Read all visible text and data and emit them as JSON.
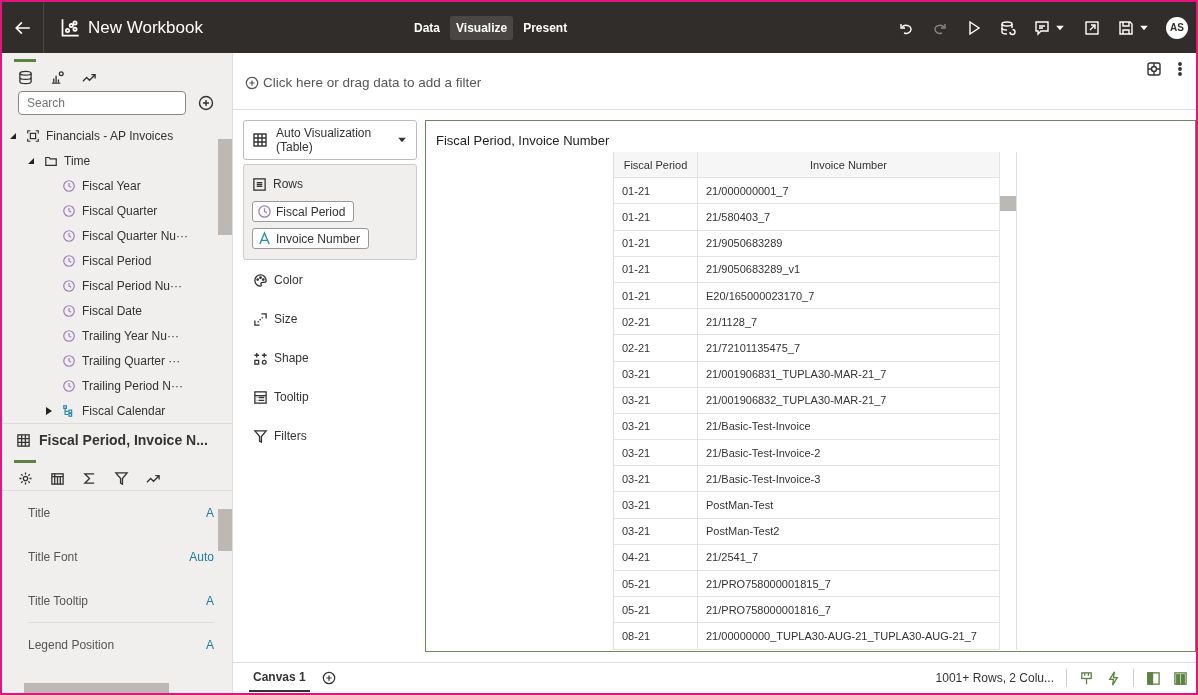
{
  "window": {
    "title": "New Workbook"
  },
  "modes": [
    {
      "label": "Data",
      "selected": false
    },
    {
      "label": "Visualize",
      "selected": true
    },
    {
      "label": "Present",
      "selected": false
    }
  ],
  "toolbar": [
    {
      "kind": "undo",
      "disabled": false
    },
    {
      "kind": "redo",
      "disabled": true
    },
    {
      "kind": "play",
      "disabled": false
    },
    {
      "kind": "refresh",
      "disabled": false
    },
    {
      "kind": "comment",
      "disabled": false
    },
    {
      "kind": "export",
      "disabled": false
    },
    {
      "kind": "save",
      "disabled": false
    }
  ],
  "user": {
    "initials": "AS"
  },
  "panel_tabs": [
    {
      "kind": "data",
      "selected": true
    },
    {
      "kind": "viz",
      "selected": false
    },
    {
      "kind": "analytics",
      "selected": false
    }
  ],
  "search": {
    "placeholder": "Search"
  },
  "tree": [
    {
      "label": "Financials - AP Invoices",
      "kind": "subject",
      "expanded": true,
      "children": [
        {
          "label": "Time",
          "kind": "folder",
          "expanded": true,
          "children": [
            {
              "label": "Fiscal Year",
              "kind": "time"
            },
            {
              "label": "Fiscal Quarter",
              "kind": "time"
            },
            {
              "label": "Fiscal Quarter Nu···",
              "kind": "time"
            },
            {
              "label": "Fiscal Period",
              "kind": "time"
            },
            {
              "label": "Fiscal Period Nu···",
              "kind": "time"
            },
            {
              "label": "Fiscal Date",
              "kind": "time"
            },
            {
              "label": "Trailing Year Nu···",
              "kind": "time"
            },
            {
              "label": "Trailing Quarter ···",
              "kind": "time"
            },
            {
              "label": "Trailing Period N···",
              "kind": "time"
            },
            {
              "label": "Fiscal Calendar",
              "kind": "hierarchy",
              "expanded": false
            }
          ]
        }
      ]
    }
  ],
  "properties": {
    "title": "Fiscal Period, Invoice N...",
    "tabs": [
      {
        "kind": "general",
        "selected": true
      },
      {
        "kind": "columns",
        "selected": false
      },
      {
        "kind": "values",
        "selected": false
      },
      {
        "kind": "filters",
        "selected": false
      },
      {
        "kind": "analytics",
        "selected": false
      }
    ],
    "rows": [
      {
        "label": "Title",
        "value": "A"
      },
      {
        "label": "Title Font",
        "value": "Auto"
      },
      {
        "label": "Title Tooltip",
        "value": "A"
      },
      {
        "label": "Legend Position",
        "value": "A"
      }
    ]
  },
  "filter_bar": {
    "prompt": "Click here or drag data to add a filter"
  },
  "grammar": {
    "viz_type": "Auto Visualization (Table)",
    "sections": [
      {
        "label": "Rows",
        "kind": "rows",
        "items": [
          {
            "label": "Fiscal Period",
            "kind": "time"
          },
          {
            "label": "Invoice Number",
            "kind": "text"
          }
        ]
      },
      {
        "label": "Color",
        "kind": "color"
      },
      {
        "label": "Size",
        "kind": "size"
      },
      {
        "label": "Shape",
        "kind": "shape"
      },
      {
        "label": "Tooltip",
        "kind": "tooltip"
      },
      {
        "label": "Filters",
        "kind": "filters"
      }
    ]
  },
  "visualization": {
    "title": "Fiscal Period, Invoice Number",
    "columns": [
      "Fiscal Period",
      "Invoice Number"
    ],
    "rows": [
      [
        "01-21",
        "21/000000001_7"
      ],
      [
        "01-21",
        "21/580403_7"
      ],
      [
        "01-21",
        "21/9050683289"
      ],
      [
        "01-21",
        "21/9050683289_v1"
      ],
      [
        "01-21",
        "E20/165000023170_7"
      ],
      [
        "02-21",
        "21/1128_7"
      ],
      [
        "02-21",
        "21/72101135475_7"
      ],
      [
        "03-21",
        "21/001906831_TUPLA30-MAR-21_7"
      ],
      [
        "03-21",
        "21/001906832_TUPLA30-MAR-21_7"
      ],
      [
        "03-21",
        "21/Basic-Test-Invoice"
      ],
      [
        "03-21",
        "21/Basic-Test-Invoice-2"
      ],
      [
        "03-21",
        "21/Basic-Test-Invoice-3"
      ],
      [
        "03-21",
        "PostMan-Test"
      ],
      [
        "03-21",
        "PostMan-Test2"
      ],
      [
        "04-21",
        "21/2541_7"
      ],
      [
        "05-21",
        "21/PRO758000001815_7"
      ],
      [
        "05-21",
        "21/PRO758000001816_7"
      ],
      [
        "08-21",
        "21/00000000_TUPLA30-AUG-21_TUPLA30-AUG-21_7"
      ]
    ]
  },
  "footer": {
    "canvases": [
      {
        "label": "Canvas 1",
        "selected": true
      }
    ],
    "status": "1001+ Rows, 2 Colu..."
  }
}
